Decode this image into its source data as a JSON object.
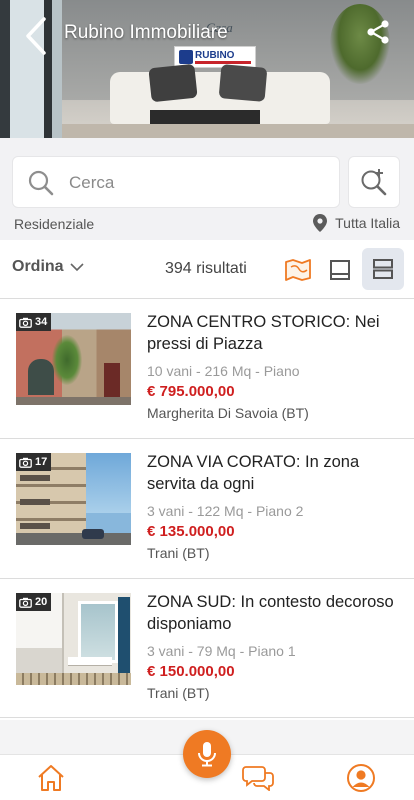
{
  "header": {
    "title": "Rubino Immobiliare",
    "back_icon": "chevron-left-icon",
    "share_icon": "share-icon",
    "logo_text": "RUBINO",
    "logo_top_text": "Casa"
  },
  "search": {
    "placeholder": "Cerca",
    "value": "",
    "category": "Residenziale",
    "location": "Tutta Italia",
    "zoom_icon": "search-plus-icon"
  },
  "toolbar": {
    "sort_label": "Ordina",
    "results": "394 risultati",
    "views": [
      "map-view",
      "card-view",
      "list-view"
    ],
    "active_view": "list-view"
  },
  "listings": [
    {
      "photos": "34",
      "title": "ZONA CENTRO STORICO: Nei pressi di Piazza",
      "details": "10 vani - 216 Mq - Piano",
      "price": "€ 795.000,00",
      "city": "Margherita Di Savoia (BT)"
    },
    {
      "photos": "17",
      "title": "ZONA VIA CORATO: In zona servita da ogni",
      "details": "3 vani - 122 Mq - Piano 2",
      "price": "€ 135.000,00",
      "city": "Trani (BT)"
    },
    {
      "photos": "20",
      "title": "ZONA SUD: In contesto decoroso disponiamo",
      "details": "3 vani - 79 Mq - Piano 1",
      "price": "€ 150.000,00",
      "city": "Trani (BT)"
    }
  ],
  "colors": {
    "accent": "#EF7A23",
    "price": "#CF1F1F",
    "active_view_bg": "#E3E7EE"
  },
  "bottom_nav": {
    "items": [
      "home-icon",
      "microphone-icon",
      "chat-icon",
      "profile-icon"
    ]
  }
}
